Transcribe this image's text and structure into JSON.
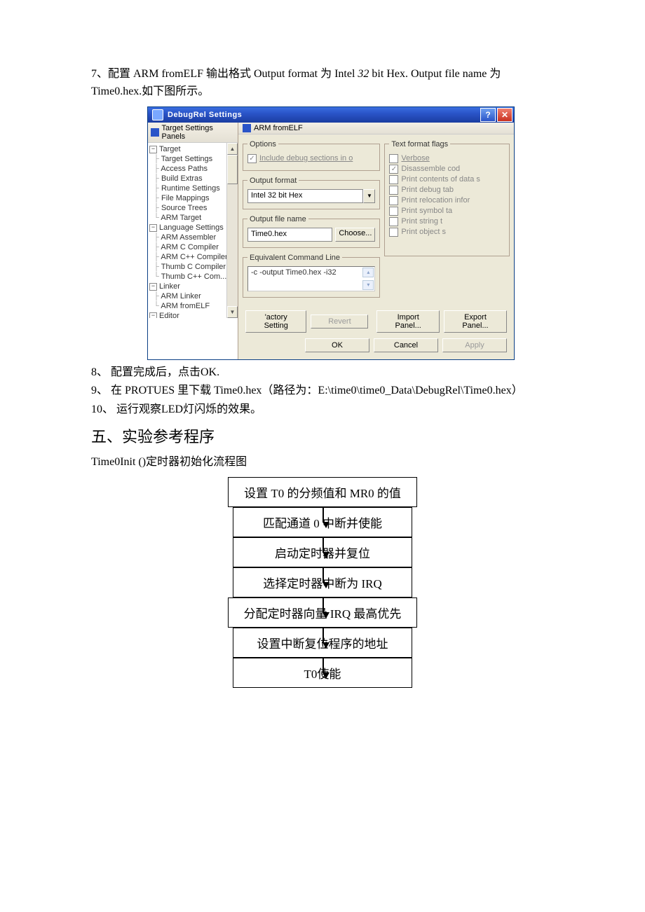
{
  "doc": {
    "p7_a": "7、配置 ARM fromELF 输出格式 Output format 为 Intel ",
    "p7_b": "32",
    "p7_c": " bit Hex. Output file name 为 Time0.hex.如下图所示。",
    "p8": "8、 配置完成后，点击OK.",
    "p9": "9、 在 PROTUES 里下载 Time0.hex（路径为：E:\\time0\\time0_Data\\DebugRel\\Time0.hex）",
    "p10": "10、 运行观察LED灯闪烁的效果。",
    "section5": "五、实验参考程序",
    "subhead": "Time0Init ()定时器初始化流程图"
  },
  "window": {
    "title": "DebugRel Settings",
    "help_icon": "?",
    "close_icon": "✕",
    "panels_header": "Target Settings Panels",
    "right_header": "ARM fromELF",
    "tree": {
      "target": "Target",
      "target_settings": "Target Settings",
      "access_paths": "Access Paths",
      "build_extras": "Build Extras",
      "runtime_settings": "Runtime Settings",
      "file_mappings": "File Mappings",
      "source_trees": "Source Trees",
      "arm_target": "ARM Target",
      "lang_settings": "Language Settings",
      "arm_assembler": "ARM Assembler",
      "arm_c_compiler": "ARM C Compiler",
      "arm_cpp_compiler": "ARM C++ Compiler",
      "thumb_c_compiler": "Thumb C Compiler",
      "thumb_cpp_com": "Thumb C++ Com...",
      "linker": "Linker",
      "arm_linker": "ARM Linker",
      "arm_fromelf": "ARM fromELF",
      "editor": "Editor"
    },
    "options": {
      "legend": "Options",
      "include_debug": "Include debug sections in o"
    },
    "outfmt": {
      "legend": "Output format",
      "value": "Intel 32 bit Hex"
    },
    "outfile": {
      "legend": "Output file name",
      "value": "Time0.hex",
      "choose": "Choose..."
    },
    "eqline": {
      "legend": "Equivalent Command Line",
      "value": "-c -output Time0.hex -i32"
    },
    "flags": {
      "legend": "Text format flags",
      "verbose": "Verbose",
      "disassemble": "Disassemble cod",
      "print_contents": "Print contents of data s",
      "print_debug": "Print debug tab",
      "print_reloc": "Print relocation infor",
      "print_symbol": "Print symbol ta",
      "print_string": "Print string t",
      "print_object": "Print object s"
    },
    "buttons": {
      "factory": "'actory Setting",
      "revert": "Revert",
      "import": "Import Panel...",
      "export": "Export Panel...",
      "ok": "OK",
      "cancel": "Cancel",
      "apply": "Apply"
    }
  },
  "flow": {
    "s1": "设置 T0 的分频值和 MR0 的值",
    "s2": "匹配通道 0 中断并使能",
    "s3": "启动定时器并复位",
    "s4": "选择定时器中断为 IRQ",
    "s5": "分配定时器向量 IRQ 最高优先",
    "s6": "设置中断复位程序的地址",
    "s7": "T0使能"
  }
}
